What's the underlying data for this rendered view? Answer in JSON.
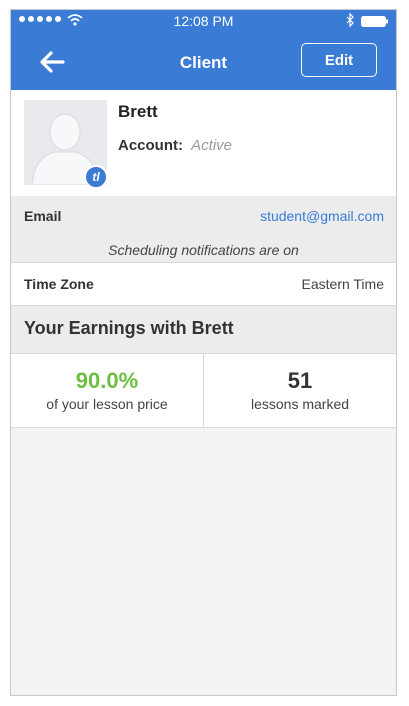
{
  "status_bar": {
    "time": "12:08 PM"
  },
  "nav": {
    "title": "Client",
    "edit_label": "Edit"
  },
  "profile": {
    "name": "Brett",
    "account_label": "Account:",
    "account_status": "Active",
    "badge_text": "tl"
  },
  "contact": {
    "email_label": "Email",
    "email_value": "student@gmail.com",
    "notification_text": "Scheduling notifications are on"
  },
  "timezone": {
    "label": "Time Zone",
    "value": "Eastern Time"
  },
  "earnings": {
    "title": "Your Earnings with Brett",
    "stats": [
      {
        "value": "90.0%",
        "caption": "of your lesson price"
      },
      {
        "value": "51",
        "caption": "lessons marked"
      }
    ]
  },
  "colors": {
    "brand_blue": "#3a7bd5",
    "accent_green": "#6cbf3f"
  },
  "icons": [
    "signal-icon",
    "wifi-icon",
    "bluetooth-icon",
    "battery-icon",
    "back-arrow-icon",
    "avatar-placeholder-icon"
  ]
}
